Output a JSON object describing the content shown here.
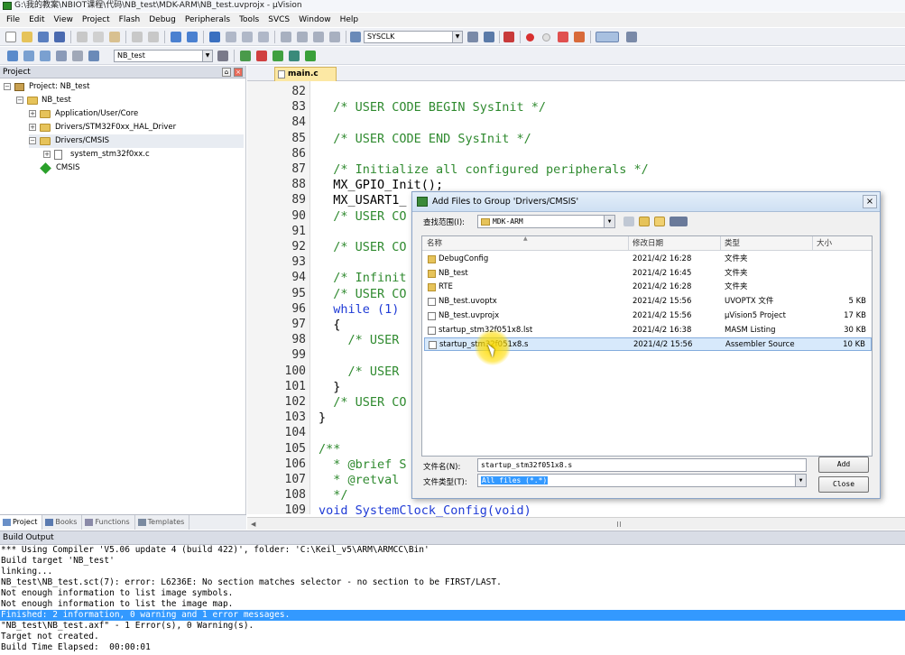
{
  "window": {
    "title": "G:\\我的教案\\NBIOT课程\\代码\\NB_test\\MDK-ARM\\NB_test.uvprojx - µVision"
  },
  "menu": [
    "File",
    "Edit",
    "View",
    "Project",
    "Flash",
    "Debug",
    "Peripherals",
    "Tools",
    "SVCS",
    "Window",
    "Help"
  ],
  "toolbar": {
    "find_combo": "SYSCLK",
    "target_combo": "NB_test"
  },
  "project_pane": {
    "title": "Project",
    "tree": [
      {
        "label": "Project: NB_test"
      },
      {
        "label": "NB_test"
      },
      {
        "label": "Application/User/Core"
      },
      {
        "label": "Drivers/STM32F0xx_HAL_Driver"
      },
      {
        "label": "Drivers/CMSIS"
      },
      {
        "label": "system_stm32f0xx.c"
      },
      {
        "label": "CMSIS"
      }
    ],
    "tabs": [
      "Project",
      "Books",
      "Functions",
      "Templates"
    ]
  },
  "editor": {
    "tab": "main.c",
    "lines": [
      {
        "n": "82",
        "text": ""
      },
      {
        "n": "83",
        "text": "  /* USER CODE BEGIN SysInit */",
        "cls": "cm"
      },
      {
        "n": "84",
        "text": ""
      },
      {
        "n": "85",
        "text": "  /* USER CODE END SysInit */",
        "cls": "cm"
      },
      {
        "n": "86",
        "text": ""
      },
      {
        "n": "87",
        "text": "  /* Initialize all configured peripherals */",
        "cls": "cm"
      },
      {
        "n": "88",
        "text": "  MX_GPIO_Init();",
        "cls": "tx"
      },
      {
        "n": "89",
        "text": "  MX_USART1_",
        "cls": "tx"
      },
      {
        "n": "90",
        "text": "  /* USER CO",
        "cls": "cm"
      },
      {
        "n": "91",
        "text": ""
      },
      {
        "n": "92",
        "text": "  /* USER CO",
        "cls": "cm"
      },
      {
        "n": "93",
        "text": ""
      },
      {
        "n": "94",
        "text": "  /* Infinit",
        "cls": "cm"
      },
      {
        "n": "95",
        "text": "  /* USER CO",
        "cls": "cm"
      },
      {
        "n": "96",
        "text": "  while (1)",
        "cls": "kw"
      },
      {
        "n": "97",
        "text": "  {",
        "cls": "tx"
      },
      {
        "n": "98",
        "text": "    /* USER",
        "cls": "cm"
      },
      {
        "n": "99",
        "text": ""
      },
      {
        "n": "100",
        "text": "    /* USER",
        "cls": "cm"
      },
      {
        "n": "101",
        "text": "  }",
        "cls": "tx"
      },
      {
        "n": "102",
        "text": "  /* USER CO",
        "cls": "cm"
      },
      {
        "n": "103",
        "text": "}",
        "cls": "tx"
      },
      {
        "n": "104",
        "text": ""
      },
      {
        "n": "105",
        "text": "/**",
        "cls": "cm"
      },
      {
        "n": "106",
        "text": "  * @brief S",
        "cls": "cm"
      },
      {
        "n": "107",
        "text": "  * @retval",
        "cls": "cm"
      },
      {
        "n": "108",
        "text": "  */",
        "cls": "cm"
      },
      {
        "n": "109",
        "text": "void SystemClock_Config(void)",
        "cls": "kw"
      }
    ]
  },
  "build_output": {
    "title": "Build Output",
    "lines": [
      "*** Using Compiler 'V5.06 update 4 (build 422)', folder: 'C:\\Keil_v5\\ARM\\ARMCC\\Bin'",
      "Build target 'NB_test'",
      "linking...",
      "NB_test\\NB_test.sct(7): error: L6236E: No section matches selector - no section to be FIRST/LAST.",
      "Not enough information to list image symbols.",
      "Not enough information to list the image map.",
      "Finished: 2 information, 0 warning and 1 error messages.",
      "\"NB_test\\NB_test.axf\" - 1 Error(s), 0 Warning(s).",
      "Target not created.",
      "Build Time Elapsed:  00:00:01"
    ],
    "highlight_index": 6
  },
  "dialog": {
    "title": "Add Files to Group 'Drivers/CMSIS'",
    "look_in_label": "查找范围(I):",
    "look_in_value": "MDK-ARM",
    "columns": [
      "名称",
      "修改日期",
      "类型",
      "大小"
    ],
    "files": [
      {
        "name": "DebugConfig",
        "date": "2021/4/2 16:28",
        "type": "文件夹",
        "size": "",
        "kind": "folder"
      },
      {
        "name": "NB_test",
        "date": "2021/4/2 16:45",
        "type": "文件夹",
        "size": "",
        "kind": "folder"
      },
      {
        "name": "RTE",
        "date": "2021/4/2 16:28",
        "type": "文件夹",
        "size": "",
        "kind": "folder"
      },
      {
        "name": "NB_test.uvoptx",
        "date": "2021/4/2 15:56",
        "type": "UVOPTX 文件",
        "size": "5 KB",
        "kind": "file"
      },
      {
        "name": "NB_test.uvprojx",
        "date": "2021/4/2 15:56",
        "type": "µVision5 Project",
        "size": "17 KB",
        "kind": "file"
      },
      {
        "name": "startup_stm32f051x8.lst",
        "date": "2021/4/2 16:38",
        "type": "MASM Listing",
        "size": "30 KB",
        "kind": "file"
      },
      {
        "name": "startup_stm32f051x8.s",
        "date": "2021/4/2 15:56",
        "type": "Assembler Source",
        "size": "10 KB",
        "kind": "file",
        "selected": true
      }
    ],
    "filename_label": "文件名(N):",
    "filename_value": "startup_stm32f051x8.s",
    "filetype_label": "文件类型(T):",
    "filetype_value": "All files (*.*)",
    "add_label": "Add",
    "close_label": "Close"
  }
}
